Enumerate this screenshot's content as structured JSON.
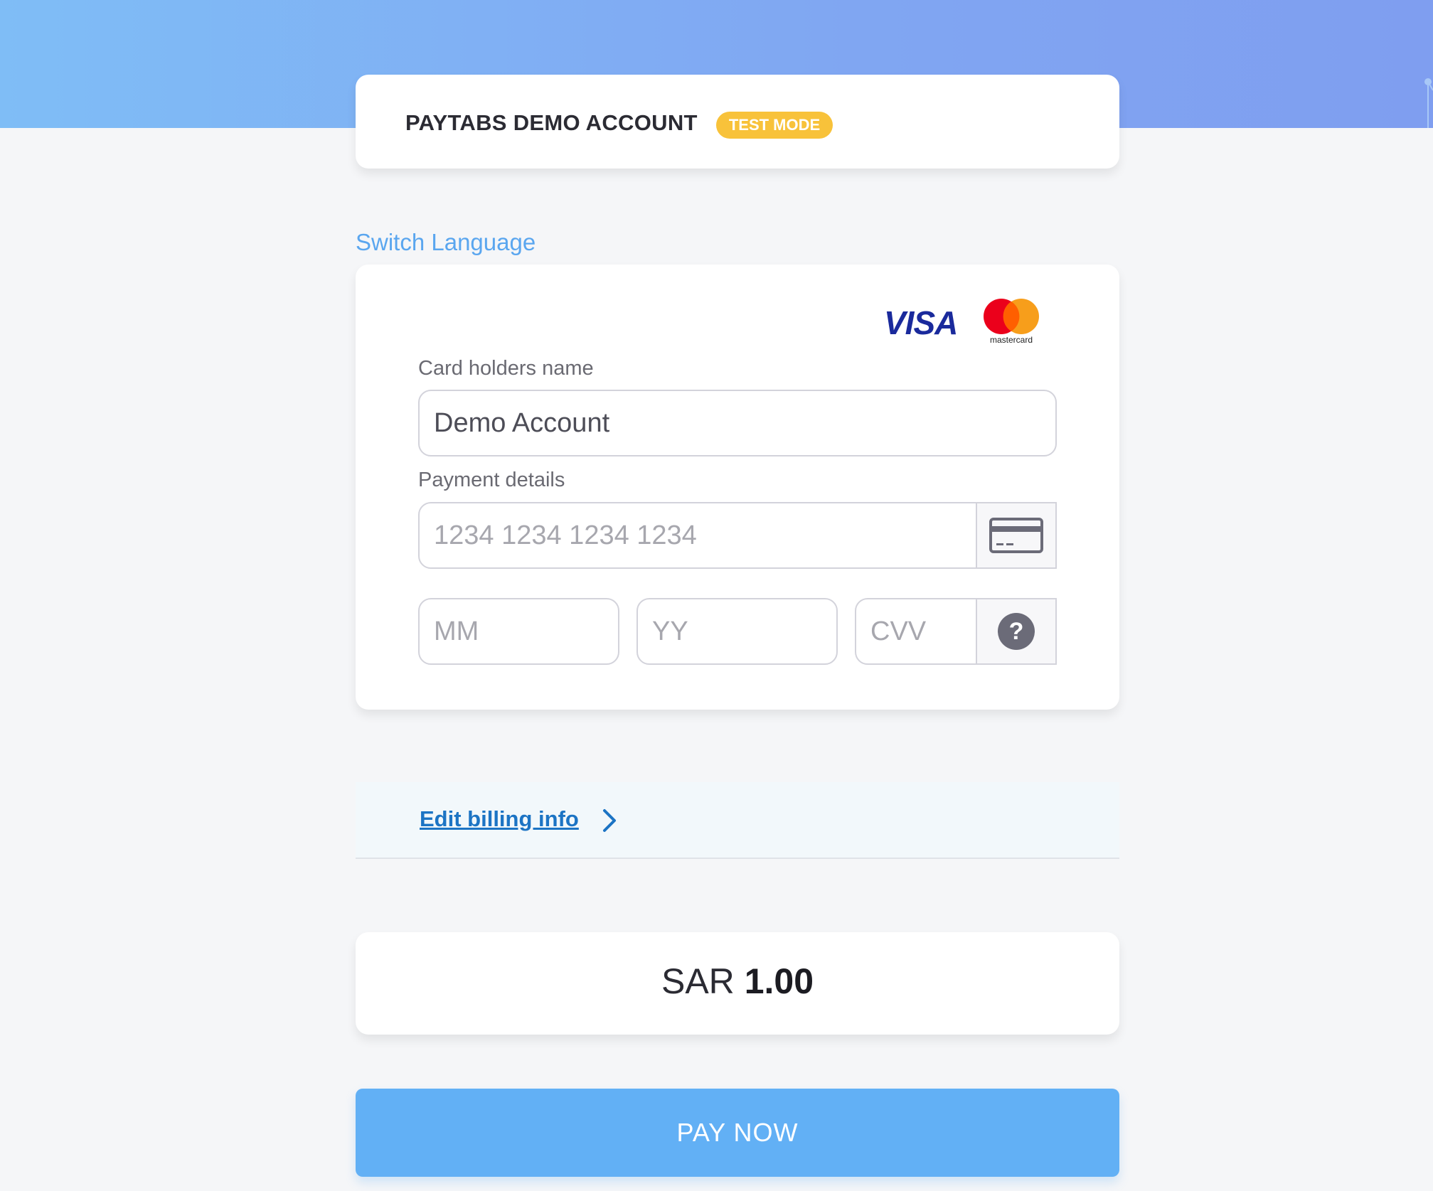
{
  "header": {
    "merchant_name": "PAYTABS DEMO ACCOUNT",
    "mode_badge": "TEST MODE"
  },
  "switch_language": "Switch Language",
  "card_brands": {
    "visa": "VISA",
    "mastercard": "mastercard"
  },
  "form": {
    "name_label": "Card holders name",
    "name_value": "Demo Account",
    "payment_label": "Payment details",
    "card_number_placeholder": "1234 1234 1234 1234",
    "month_placeholder": "MM",
    "year_placeholder": "YY",
    "cvv_placeholder": "CVV",
    "cvv_help_symbol": "?"
  },
  "billing": {
    "edit_link": "Edit billing info"
  },
  "amount": {
    "currency": "SAR",
    "value": "1.00"
  },
  "pay_button": "PAY NOW",
  "colors": {
    "accent": "#62b0f5",
    "link": "#1c74c4",
    "badge": "#f8c23a"
  }
}
